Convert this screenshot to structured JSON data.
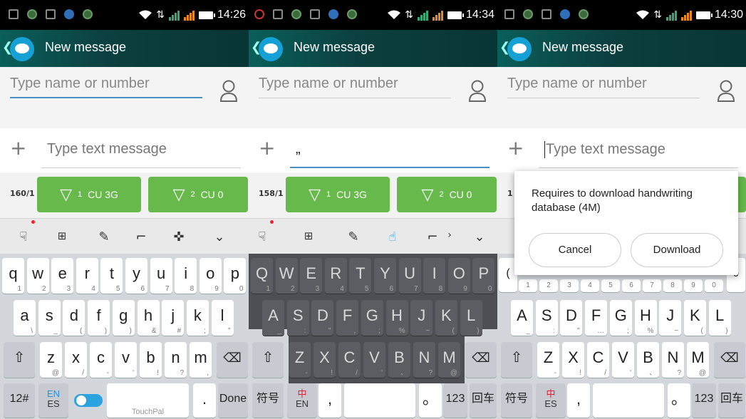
{
  "panels": [
    {
      "status": {
        "time": "14:26"
      },
      "header": {
        "title": "New message"
      },
      "to_placeholder": "Type name or number",
      "message_text": "Type text message",
      "counter": "160/1",
      "send_buttons": [
        {
          "label": "CU 3G",
          "sim": "1"
        },
        {
          "label": "CU 0",
          "sim": "2"
        }
      ],
      "keyboard": {
        "row1": [
          [
            "q",
            "1"
          ],
          [
            "w",
            "2"
          ],
          [
            "e",
            "3"
          ],
          [
            "r",
            "4"
          ],
          [
            "t",
            "5"
          ],
          [
            "y",
            "6"
          ],
          [
            "u",
            "7"
          ],
          [
            "i",
            "8"
          ],
          [
            "o",
            "9"
          ],
          [
            "p",
            "0"
          ]
        ],
        "row2": [
          [
            "a",
            "\\"
          ],
          [
            "s",
            "_"
          ],
          [
            "d",
            "("
          ],
          [
            "f",
            ")"
          ],
          [
            "g",
            ")"
          ],
          [
            "h",
            "&"
          ],
          [
            "j",
            "#"
          ],
          [
            "k",
            ";"
          ],
          [
            "l",
            "\""
          ]
        ],
        "row3": [
          [
            "z",
            "@"
          ],
          [
            "x",
            "/"
          ],
          [
            "c",
            "-"
          ],
          [
            "v",
            "'"
          ],
          [
            "b",
            "!"
          ],
          [
            "n",
            "?"
          ],
          [
            "m",
            ","
          ]
        ],
        "bottom": {
          "k12": "12#",
          "lang_top": "EN",
          "lang_bottom": "ES",
          "space": "TouchPal",
          "period": ".",
          "done": "Done"
        }
      }
    },
    {
      "status": {
        "time": "14:34"
      },
      "header": {
        "title": "New message"
      },
      "to_placeholder": "Type name or number",
      "message_text": "„",
      "counter": "158/1",
      "send_buttons": [
        {
          "label": "CU 3G",
          "sim": "1"
        },
        {
          "label": "CU 0",
          "sim": "2"
        }
      ],
      "keyboard": {
        "row1": [
          [
            "Q",
            "1"
          ],
          [
            "W",
            "2"
          ],
          [
            "E",
            "3"
          ],
          [
            "R",
            "4"
          ],
          [
            "T",
            "5"
          ],
          [
            "Y",
            "6"
          ],
          [
            "U",
            "7"
          ],
          [
            "I",
            "8"
          ],
          [
            "O",
            "9"
          ],
          [
            "P",
            "0"
          ]
        ],
        "row2": [
          [
            "A",
            "_"
          ],
          [
            "S",
            ":"
          ],
          [
            "D",
            "\""
          ],
          [
            "F",
            ","
          ],
          [
            "G",
            ";"
          ],
          [
            "H",
            "%"
          ],
          [
            "J",
            "~"
          ],
          [
            "K",
            "("
          ],
          [
            "L",
            ")"
          ]
        ],
        "row3": [
          [
            "Z",
            "-"
          ],
          [
            "X",
            "!"
          ],
          [
            "C",
            "/"
          ],
          [
            "V",
            "'"
          ],
          [
            "B",
            "、"
          ],
          [
            "N",
            "?"
          ],
          [
            "M",
            "@"
          ]
        ],
        "bottom": {
          "sym": "符号",
          "lang_top": "中",
          "lang_bottom": "EN",
          "comma": ",",
          "period": "。",
          "num": "123",
          "enter": "回车"
        }
      }
    },
    {
      "status": {
        "time": "14:30"
      },
      "header": {
        "title": "New message"
      },
      "to_placeholder": "Type name or number",
      "message_text": "Type text message",
      "counter": "1",
      "dialog": {
        "text": "Requires to download handwriting database (4M)",
        "cancel": "Cancel",
        "download": "Download"
      },
      "keyboard": {
        "row1_left": "(",
        "row1_right": "ↄ",
        "row1_subs": [
          "1",
          "2",
          "3",
          "4",
          "5",
          "6",
          "7",
          "8",
          "9",
          "0"
        ],
        "row2": [
          [
            "A",
            "_"
          ],
          [
            "S",
            ":"
          ],
          [
            "D",
            "\""
          ],
          [
            "F",
            "…"
          ],
          [
            "G",
            ";"
          ],
          [
            "H",
            "%"
          ],
          [
            "J",
            "~"
          ],
          [
            "K",
            "("
          ],
          [
            "L",
            ")"
          ]
        ],
        "row3": [
          [
            "Z",
            "-"
          ],
          [
            "X",
            "!"
          ],
          [
            "C",
            "/"
          ],
          [
            "V",
            "'"
          ],
          [
            "B",
            "、"
          ],
          [
            "N",
            "?"
          ],
          [
            "M",
            "@"
          ]
        ],
        "bottom": {
          "sym": "符号",
          "lang_top": "中",
          "lang_bottom": "ES",
          "comma": ",",
          "period": "。",
          "num": "123",
          "enter": "回车"
        }
      }
    }
  ]
}
